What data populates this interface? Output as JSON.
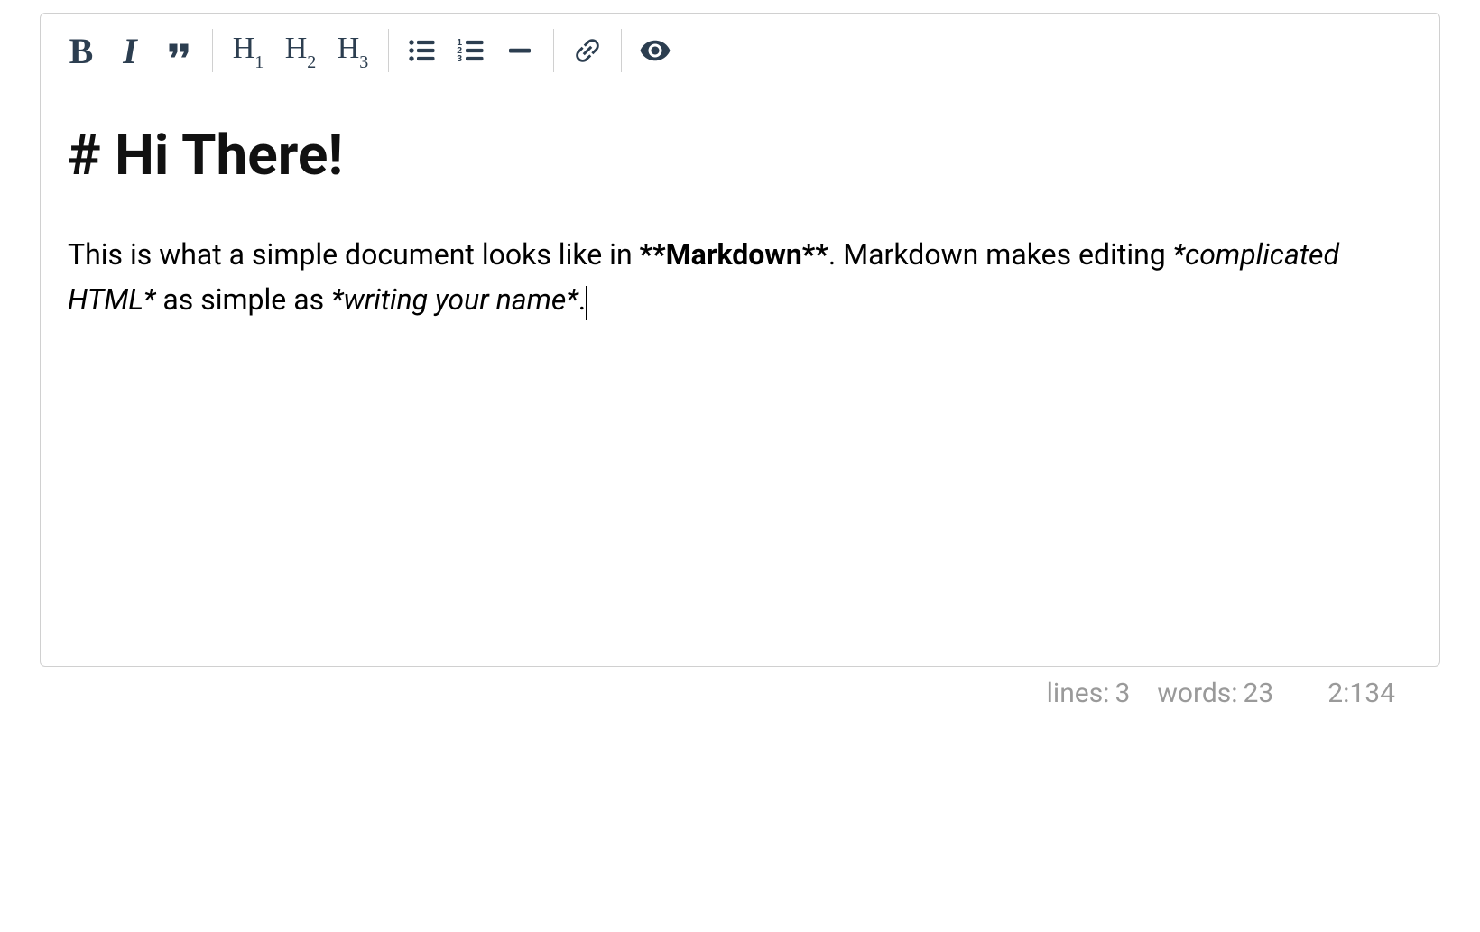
{
  "toolbar": {
    "bold_glyph": "B",
    "italic_glyph": "I",
    "h1_label": "H",
    "h1_sub": "1",
    "h2_label": "H",
    "h2_sub": "2",
    "h3_label": "H",
    "h3_sub": "3"
  },
  "content": {
    "heading": "# Hi There!",
    "para_part1": "This is what a simple document looks like in ",
    "para_bold": "**Markdown**",
    "para_part2": ". Markdown makes editing ",
    "para_italic1": "*complicated HTML*",
    "para_part3": " as simple as ",
    "para_italic2": "*writing your name*",
    "para_part4": "."
  },
  "statusbar": {
    "lines_label": "lines:",
    "lines_value": "3",
    "words_label": "words:",
    "words_value": "23",
    "cursor_position": "2:134"
  }
}
